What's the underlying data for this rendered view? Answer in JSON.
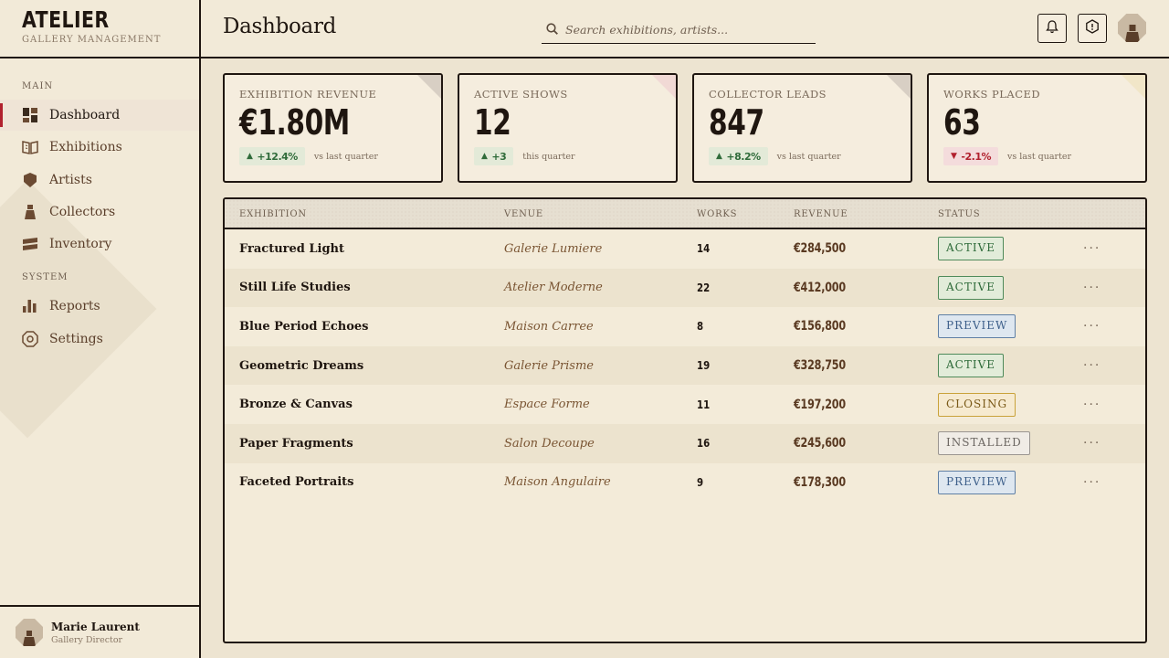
{
  "brand": {
    "title": "ATELIER",
    "subtitle": "GALLERY MANAGEMENT"
  },
  "sidebar": {
    "sections": [
      {
        "title": "MAIN"
      },
      {
        "title": "SYSTEM"
      }
    ],
    "items": [
      {
        "label": "Dashboard",
        "icon": "dashboard-icon",
        "active": true
      },
      {
        "label": "Exhibitions",
        "icon": "book-icon"
      },
      {
        "label": "Artists",
        "icon": "shield-icon"
      },
      {
        "label": "Collectors",
        "icon": "person-icon"
      },
      {
        "label": "Inventory",
        "icon": "stack-icon"
      },
      {
        "label": "Reports",
        "icon": "bar-chart-icon"
      },
      {
        "label": "Settings",
        "icon": "octagon-settings-icon"
      }
    ]
  },
  "profile": {
    "name": "Marie Laurent",
    "role": "Gallery Director"
  },
  "header": {
    "title": "Dashboard",
    "search_placeholder": "Search exhibitions, artists..."
  },
  "stats": [
    {
      "label": "EXHIBITION REVENUE",
      "value": "€1.80M",
      "delta": "+12.4%",
      "direction": "up",
      "note": "vs last quarter",
      "fold_color": "#d8cfc4"
    },
    {
      "label": "ACTIVE SHOWS",
      "value": "12",
      "delta": "+3",
      "direction": "up",
      "note": "this quarter",
      "fold_color": "#f1d9d5"
    },
    {
      "label": "COLLECTOR LEADS",
      "value": "847",
      "delta": "+8.2%",
      "direction": "up",
      "note": "vs last quarter",
      "fold_color": "#d8cfc4"
    },
    {
      "label": "WORKS PLACED",
      "value": "63",
      "delta": "-2.1%",
      "direction": "down",
      "note": "vs last quarter",
      "fold_color": "#f1e6c8"
    }
  ],
  "table": {
    "columns": [
      "EXHIBITION",
      "VENUE",
      "WORKS",
      "REVENUE",
      "STATUS"
    ],
    "rows": [
      {
        "name": "Fractured Light",
        "venue": "Galerie Lumiere",
        "works": "14",
        "revenue": "€284,500",
        "status": "ACTIVE"
      },
      {
        "name": "Still Life Studies",
        "venue": "Atelier Moderne",
        "works": "22",
        "revenue": "€412,000",
        "status": "ACTIVE"
      },
      {
        "name": "Blue Period Echoes",
        "venue": "Maison Carree",
        "works": "8",
        "revenue": "€156,800",
        "status": "PREVIEW"
      },
      {
        "name": "Geometric Dreams",
        "venue": "Galerie Prisme",
        "works": "19",
        "revenue": "€328,750",
        "status": "ACTIVE"
      },
      {
        "name": "Bronze & Canvas",
        "venue": "Espace Forme",
        "works": "11",
        "revenue": "€197,200",
        "status": "CLOSING"
      },
      {
        "name": "Paper Fragments",
        "venue": "Salon Decoupe",
        "works": "16",
        "revenue": "€245,600",
        "status": "INSTALLED"
      },
      {
        "name": "Faceted Portraits",
        "venue": "Maison Angulaire",
        "works": "9",
        "revenue": "€178,300",
        "status": "PREVIEW"
      }
    ],
    "row_action": "···"
  },
  "colors": {
    "accent": "#b1212e",
    "ink": "#1f1610",
    "paper": "#f2ead8",
    "status_active": "#2f6b3a",
    "status_preview": "#3d5f8a",
    "status_closing": "#c9a23a",
    "status_installed": "#6a6560"
  }
}
